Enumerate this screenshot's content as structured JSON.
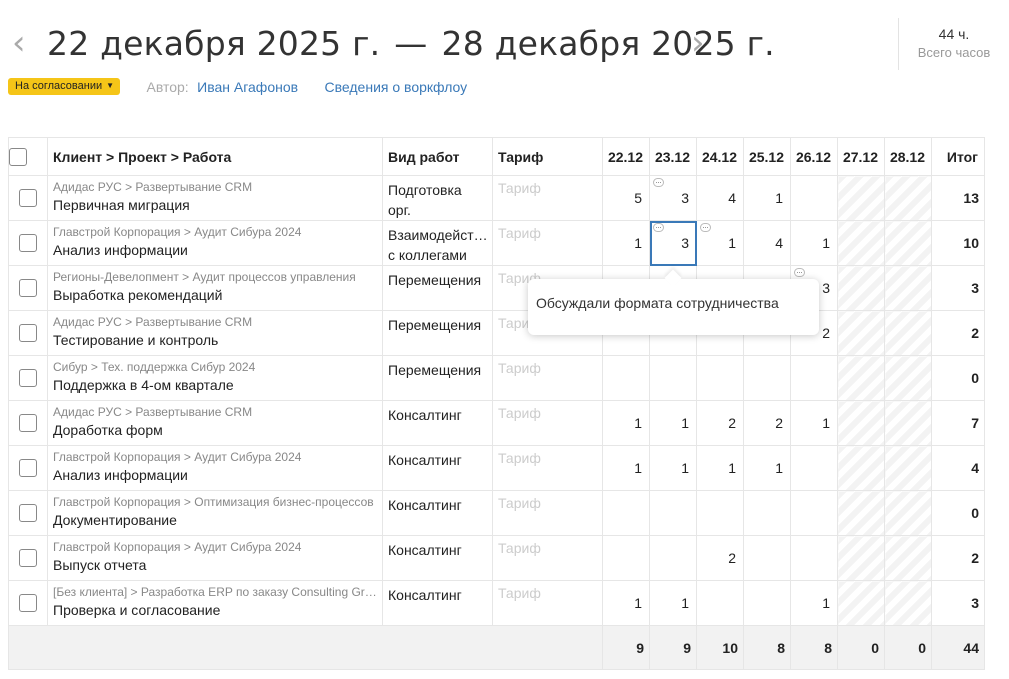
{
  "header": {
    "prev_arrow": "‹",
    "next_arrow": "›",
    "period_start": "22 декабря 2025 г.",
    "period_separator": "—",
    "period_end": "28 декабря 2025 г.",
    "total_hours": "44 ч.",
    "total_label": "Всего часов"
  },
  "meta": {
    "status": "На согласовании",
    "author_label": "Автор:",
    "author_name": "Иван Агафонов",
    "workflow_link": "Сведения о воркфлоу"
  },
  "columns": {
    "task": "Клиент > Проект > Работа",
    "worktype": "Вид работ",
    "tariff": "Тариф",
    "days": [
      "22.12",
      "23.12",
      "24.12",
      "25.12",
      "26.12",
      "27.12",
      "28.12"
    ],
    "total": "Итог"
  },
  "weekend_days": [
    5,
    6
  ],
  "rows": [
    {
      "path": "Адидас РУС > Развертывание CRM",
      "name": "Первичная миграция",
      "worktype": "Подготовка",
      "worktype2": "орг.",
      "tariff": "Тариф",
      "hours": [
        "5",
        "3",
        "4",
        "1",
        "",
        "",
        ""
      ],
      "comments": [
        1
      ],
      "total": "13"
    },
    {
      "path": "Главстрой Корпорация > Аудит Сибура 2024",
      "name": "Анализ информации",
      "worktype": "Взаимодейств...",
      "worktype2": "с коллегами",
      "tariff": "Тариф",
      "hours": [
        "1",
        "3",
        "1",
        "4",
        "1",
        "",
        ""
      ],
      "comments": [
        1,
        2
      ],
      "total": "10",
      "selected": 1
    },
    {
      "path": "Регионы-Девелопмент > Аудит процессов управления",
      "name": "Выработка рекомендаций",
      "worktype": "Перемещения",
      "worktype2": "",
      "tariff": "Тариф",
      "hours": [
        "",
        "",
        "",
        "",
        "3",
        "",
        ""
      ],
      "comments": [
        4
      ],
      "total": "3"
    },
    {
      "path": "Адидас РУС > Развертывание CRM",
      "name": "Тестирование и контроль",
      "worktype": "Перемещения",
      "worktype2": "",
      "tariff": "Тариф",
      "hours": [
        "",
        "",
        "",
        "",
        "2",
        "",
        ""
      ],
      "comments": [],
      "total": "2"
    },
    {
      "path": "Сибур > Тех. поддержка Сибур 2024",
      "name": "Поддержка в 4-ом квартале",
      "worktype": "Перемещения",
      "worktype2": "",
      "tariff": "Тариф",
      "hours": [
        "",
        "",
        "",
        "",
        "",
        "",
        ""
      ],
      "comments": [],
      "total": "0"
    },
    {
      "path": "Адидас РУС > Развертывание CRM",
      "name": "Доработка форм",
      "worktype": "Консалтинг",
      "worktype2": "",
      "tariff": "Тариф",
      "hours": [
        "1",
        "1",
        "2",
        "2",
        "1",
        "",
        ""
      ],
      "comments": [],
      "total": "7"
    },
    {
      "path": "Главстрой Корпорация > Аудит Сибура 2024",
      "name": "Анализ информации",
      "worktype": "Консалтинг",
      "worktype2": "",
      "tariff": "Тариф",
      "hours": [
        "1",
        "1",
        "1",
        "1",
        "",
        "",
        ""
      ],
      "comments": [],
      "total": "4"
    },
    {
      "path": "Главстрой Корпорация > Оптимизация бизнес-процессов",
      "name": "Документирование",
      "worktype": "Консалтинг",
      "worktype2": "",
      "tariff": "Тариф",
      "hours": [
        "",
        "",
        "",
        "",
        "",
        "",
        ""
      ],
      "comments": [],
      "total": "0"
    },
    {
      "path": "Главстрой Корпорация > Аудит Сибура 2024",
      "name": "Выпуск отчета",
      "worktype": "Консалтинг",
      "worktype2": "",
      "tariff": "Тариф",
      "hours": [
        "",
        "",
        "2",
        "",
        "",
        "",
        ""
      ],
      "comments": [],
      "total": "2"
    },
    {
      "path": "[Без клиента] > Разработка ERP по заказу Consulting Group...",
      "name": "Проверка и согласование",
      "worktype": "Консалтинг",
      "worktype2": "",
      "tariff": "Тариф",
      "hours": [
        "1",
        "1",
        "",
        "",
        "1",
        "",
        ""
      ],
      "comments": [],
      "total": "3"
    }
  ],
  "footer": {
    "day_totals": [
      "9",
      "9",
      "10",
      "8",
      "8",
      "0",
      "0"
    ],
    "grand_total": "44"
  },
  "tooltip": {
    "text": "Обсуждали формата сотрудничества"
  },
  "colors": {
    "status_badge": "#f5c518",
    "link": "#3a79b8",
    "selection": "#3a79b8"
  }
}
